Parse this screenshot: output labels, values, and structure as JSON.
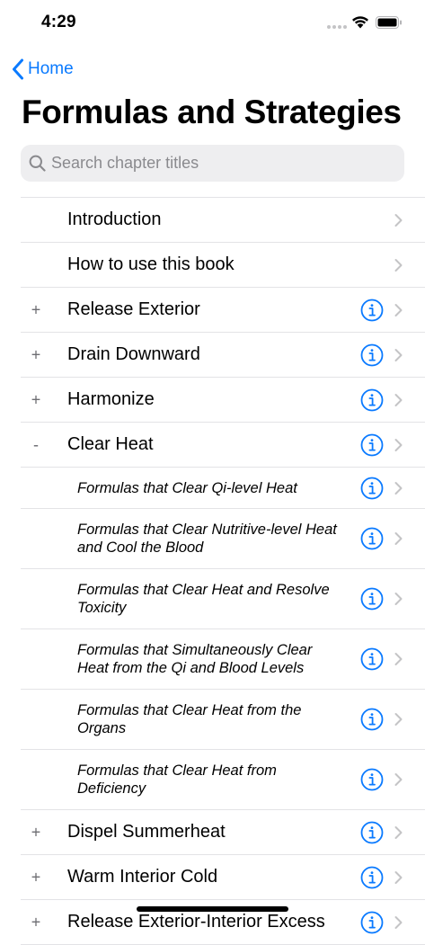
{
  "status": {
    "time": "4:29"
  },
  "nav": {
    "back_label": "Home",
    "title": "Formulas and Strategies"
  },
  "search": {
    "placeholder": "Search chapter titles",
    "value": ""
  },
  "colors": {
    "accent": "#0a7aff",
    "separator": "#e3e3e6",
    "chevron": "#c4c4c6"
  },
  "rows": [
    {
      "title": "Introduction",
      "expander": "",
      "info": false
    },
    {
      "title": "How to use this book",
      "expander": "",
      "info": false
    },
    {
      "title": "Release Exterior",
      "expander": "+",
      "info": true
    },
    {
      "title": "Drain Downward",
      "expander": "+",
      "info": true
    },
    {
      "title": "Harmonize",
      "expander": "+",
      "info": true
    },
    {
      "title": "Clear Heat",
      "expander": "-",
      "info": true
    },
    {
      "title": "Formulas that Clear Qi-level Heat",
      "sub": true
    },
    {
      "title": "Formulas that Clear Nutritive-level Heat and Cool the Blood",
      "sub": true
    },
    {
      "title": "Formulas that Clear Heat and Resolve Toxicity",
      "sub": true
    },
    {
      "title": "Formulas that Simultaneously Clear Heat from the Qi and Blood Levels",
      "sub": true
    },
    {
      "title": "Formulas that Clear Heat from the Organs",
      "sub": true
    },
    {
      "title": "Formulas that Clear Heat from Deficiency",
      "sub": true
    },
    {
      "title": "Dispel Summerheat",
      "expander": "+",
      "info": true
    },
    {
      "title": "Warm Interior Cold",
      "expander": "+",
      "info": true
    },
    {
      "title": "Release Exterior-Interior Excess",
      "expander": "+",
      "info": true
    }
  ]
}
